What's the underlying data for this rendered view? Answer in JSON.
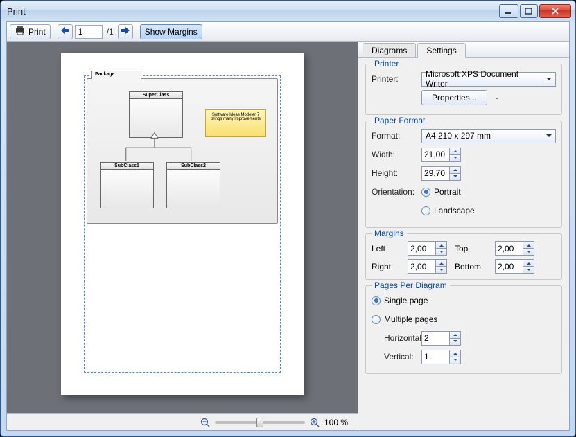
{
  "window": {
    "title": "Print"
  },
  "toolbar": {
    "print_label": "Print",
    "page_current": "1",
    "page_total": "/1",
    "show_margins_label": "Show Margins"
  },
  "zoom": {
    "percent": "100 %"
  },
  "tabs": {
    "diagrams": "Diagrams",
    "settings": "Settings"
  },
  "printer": {
    "group": "Printer",
    "label": "Printer:",
    "selected": "Microsoft XPS Document Writer",
    "properties_btn": "Properties...",
    "dash": "-"
  },
  "paper": {
    "group": "Paper Format",
    "format_label": "Format:",
    "format_value": "A4 210 x 297 mm",
    "width_label": "Width:",
    "width_value": "21,00",
    "height_label": "Height:",
    "height_value": "29,70",
    "orientation_label": "Orientation:",
    "portrait": "Portrait",
    "landscape": "Landscape"
  },
  "margins": {
    "group": "Margins",
    "left_label": "Left",
    "left_value": "2,00",
    "top_label": "Top",
    "top_value": "2,00",
    "right_label": "Right",
    "right_value": "2,00",
    "bottom_label": "Bottom",
    "bottom_value": "2,00"
  },
  "ppd": {
    "group": "Pages Per Diagram",
    "single": "Single page",
    "multiple": "Multiple pages",
    "horizontal_label": "Horizontal:",
    "horizontal_value": "2",
    "vertical_label": "Vertical:",
    "vertical_value": "1"
  },
  "diagram": {
    "package": "Package",
    "superclass": "SuperClass",
    "subclass1": "SubClass1",
    "subclass2": "SubClass2",
    "note": "Software Ideas Modeler 7 brings many improvements"
  }
}
